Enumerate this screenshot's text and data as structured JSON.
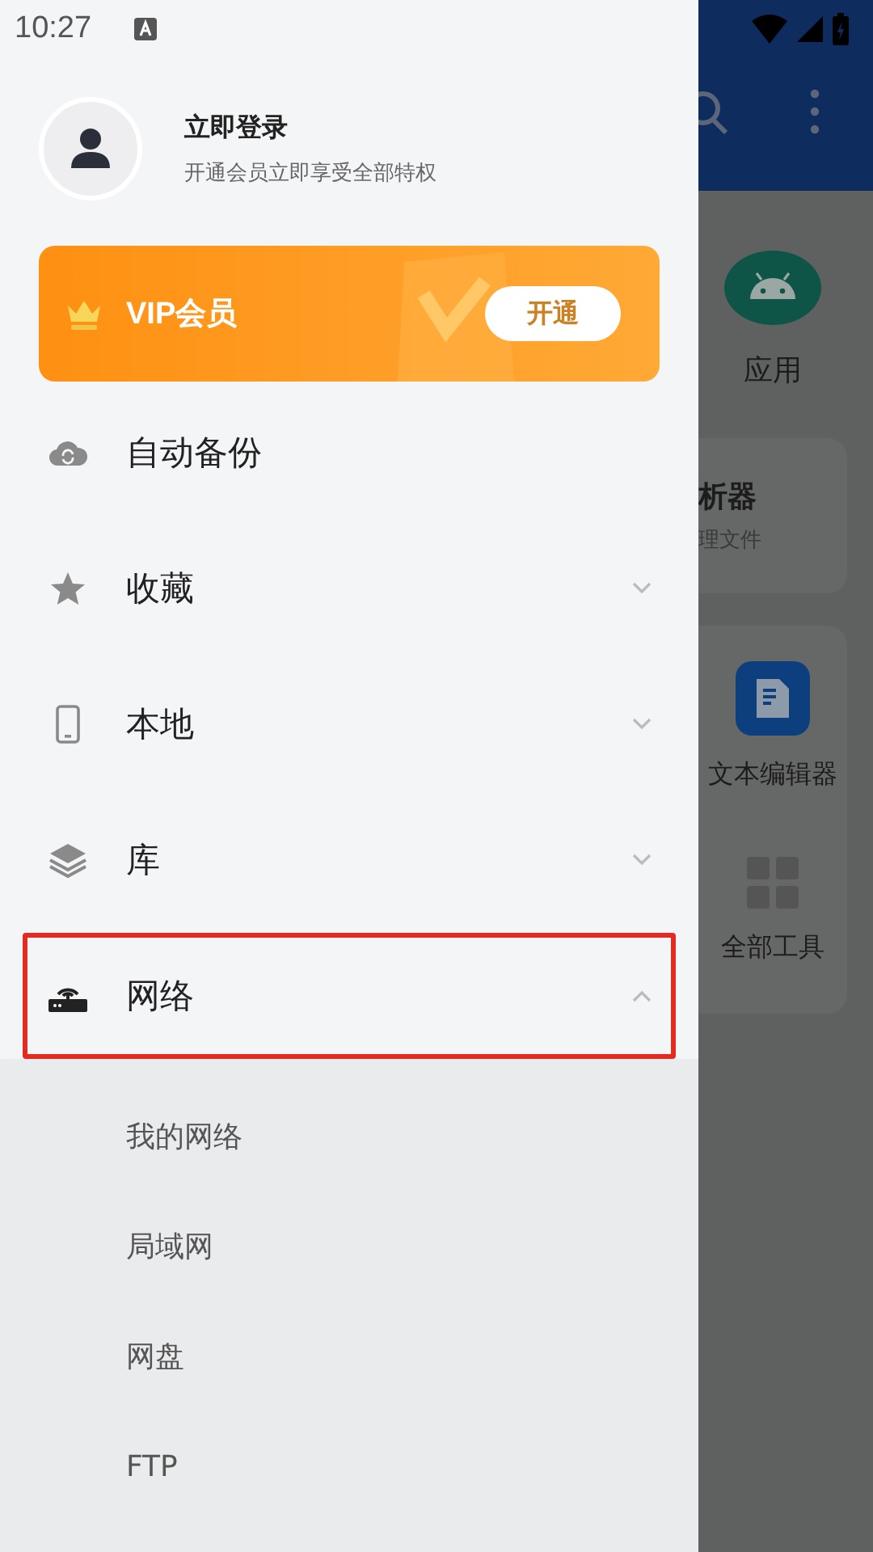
{
  "status_bar": {
    "time": "10:27"
  },
  "drawer": {
    "profile": {
      "title": "立即登录",
      "subtitle": "开通会员立即享受全部特权"
    },
    "vip": {
      "label": "VIP会员",
      "button": "开通"
    },
    "menu": [
      {
        "label": "自动备份",
        "kind": "cloud",
        "expandable": false,
        "highlighted": false
      },
      {
        "label": "收藏",
        "kind": "star",
        "expandable": true,
        "expanded": false,
        "highlighted": false
      },
      {
        "label": "本地",
        "kind": "phone",
        "expandable": true,
        "expanded": false,
        "highlighted": false
      },
      {
        "label": "库",
        "kind": "layers",
        "expandable": true,
        "expanded": false,
        "highlighted": false
      },
      {
        "label": "网络",
        "kind": "router",
        "expandable": true,
        "expanded": true,
        "highlighted": true,
        "children": [
          {
            "label": "我的网络"
          },
          {
            "label": "局域网"
          },
          {
            "label": "网盘"
          },
          {
            "label": "FTP"
          }
        ]
      }
    ]
  },
  "background_app": {
    "app_label": "应用",
    "card_title": "析器",
    "card_subtitle": "理文件",
    "tools": [
      {
        "label": "文本编辑器",
        "kind": "editor"
      },
      {
        "label": "全部工具",
        "kind": "grid"
      }
    ]
  }
}
